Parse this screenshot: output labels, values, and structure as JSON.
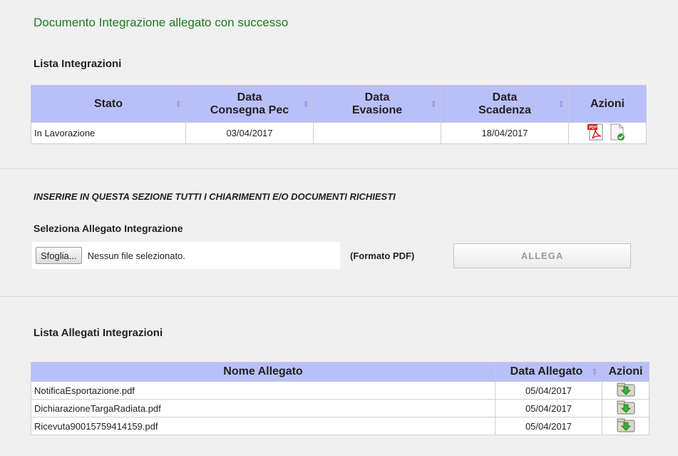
{
  "success_message": "Documento Integrazione allegato con successo",
  "integrations": {
    "title": "Lista Integrazioni",
    "columns": {
      "stato": "Stato",
      "data_consegna_1": "Data",
      "data_consegna_2": "Consegna Pec",
      "data_evasione_1": "Data",
      "data_evasione_2": "Evasione",
      "data_scadenza_1": "Data",
      "data_scadenza_2": "Scadenza",
      "azioni": "Azioni"
    },
    "rows": [
      {
        "stato": "In Lavorazione",
        "data_consegna": "03/04/2017",
        "data_evasione": "",
        "data_scadenza": "18/04/2017",
        "actions": [
          "pdf-icon",
          "document-approved-icon"
        ]
      }
    ]
  },
  "upload": {
    "instruction": "INSERIRE IN QUESTA SEZIONE TUTTI I CHIARIMENTI E/O DOCUMENTI RICHIESTI",
    "label": "Seleziona Allegato Integrazione",
    "browse_label": "Sfoglia...",
    "file_status": "Nessun file selezionato.",
    "format_label": "(Formato PDF)",
    "attach_label": "ALLEGA"
  },
  "attachments": {
    "title": "Lista Allegati Integrazioni",
    "columns": {
      "nome": "Nome Allegato",
      "data": "Data Allegato",
      "azioni": "Azioni"
    },
    "rows": [
      {
        "nome": "NotificaEsportazione.pdf",
        "data": "05/04/2017"
      },
      {
        "nome": "DichiarazioneTargaRadiata.pdf",
        "data": "05/04/2017"
      },
      {
        "nome": "Ricevuta90015759414159.pdf",
        "data": "05/04/2017"
      }
    ],
    "action_icon": "download-folder-icon"
  },
  "colors": {
    "success": "#1f7a1f",
    "header_bg": "#b9bff8",
    "page_bg": "#f0f0f0"
  }
}
